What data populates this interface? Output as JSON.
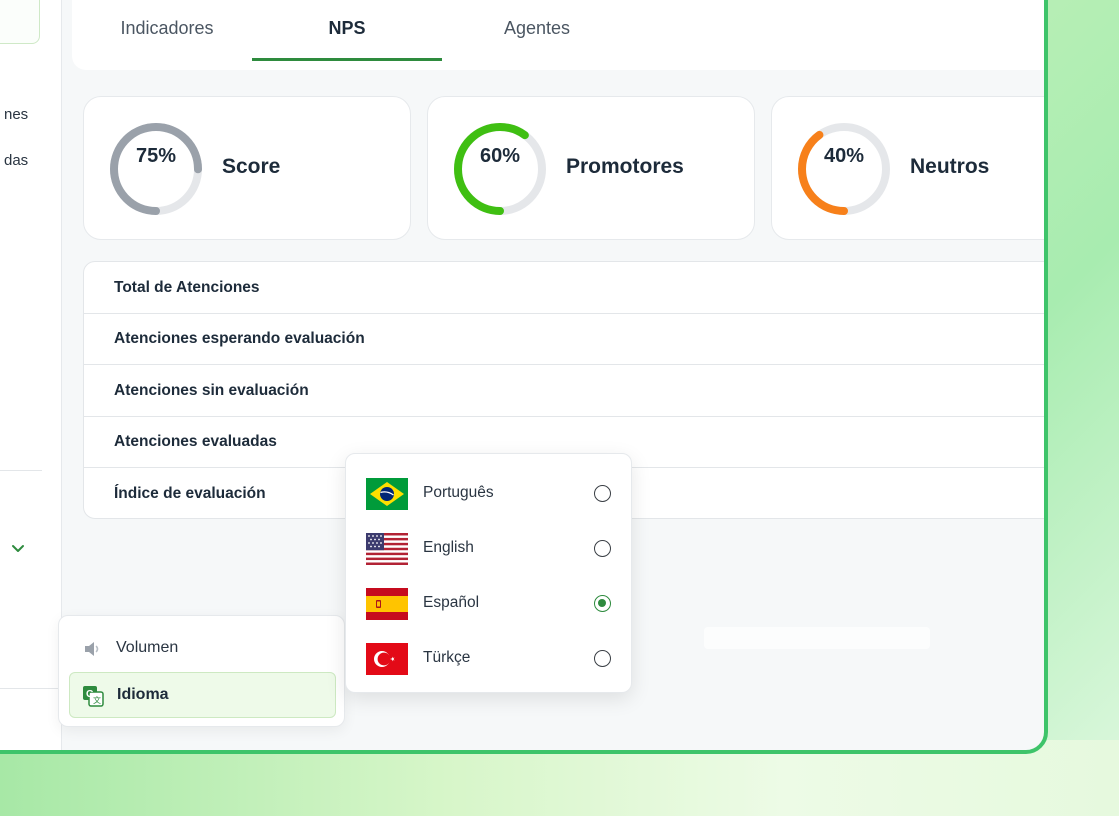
{
  "sidebar": {
    "item_1_partial": "nes",
    "item_2_partial": "das"
  },
  "tabs": [
    {
      "label": "Indicadores"
    },
    {
      "label": "NPS"
    },
    {
      "label": "Agentes"
    }
  ],
  "cards": [
    {
      "percent": "75%",
      "label": "Score",
      "value": 0.75,
      "color": "#9aa1aa"
    },
    {
      "percent": "60%",
      "label": "Promotores",
      "value": 0.6,
      "color": "#3fbf12"
    },
    {
      "percent": "40%",
      "label": "Neutros",
      "value": 0.4,
      "color": "#f7801a"
    }
  ],
  "table": {
    "rows": [
      "Total de Atenciones",
      "Atenciones esperando evaluación",
      "Atenciones sin evaluación",
      "Atenciones evaluadas",
      "Índice de evaluación"
    ]
  },
  "settings_menu": {
    "volume_label": "Volumen",
    "language_label": "Idioma"
  },
  "language_menu": {
    "options": [
      {
        "label": "Português",
        "flag": "brazil-flag",
        "selected": false
      },
      {
        "label": "English",
        "flag": "usa-flag",
        "selected": false
      },
      {
        "label": "Español",
        "flag": "spain-flag",
        "selected": true
      },
      {
        "label": "Türkçe",
        "flag": "turkey-flag",
        "selected": false
      }
    ]
  },
  "colors": {
    "accent_green": "#2e8b3e",
    "frame_border": "#3ec46a"
  }
}
